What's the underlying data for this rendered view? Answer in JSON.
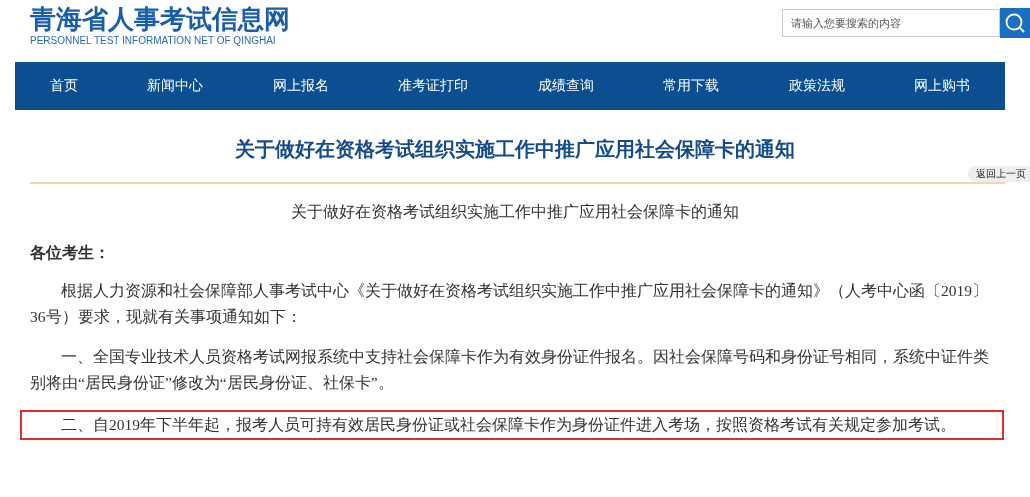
{
  "site": {
    "title": "青海省人事考试信息网",
    "subtitle": "PERSONNEL TEST INFORMATION NET OF QINGHAI"
  },
  "search": {
    "placeholder": "请输入您要搜索的内容"
  },
  "nav": [
    "首页",
    "新闻中心",
    "网上报名",
    "准考证打印",
    "成绩查询",
    "常用下载",
    "政策法规",
    "网上购书"
  ],
  "article": {
    "title": "关于做好在资格考试组织实施工作中推广应用社会保障卡的通知",
    "back_button": "返回上一页",
    "heading": "关于做好在资格考试组织实施工作中推广应用社会保障卡的通知",
    "salutation": "各位考生：",
    "paragraphs": [
      {
        "text": "根据人力资源和社会保障部人事考试中心《关于做好在资格考试组织实施工作中推广应用社会保障卡的通知》（人考中心函〔2019〕36号）要求，现就有关事项通知如下：",
        "highlighted": false
      },
      {
        "text": "一、全国专业技术人员资格考试网报系统中支持社会保障卡作为有效身份证件报名。因社会保障号码和身份证号相同，系统中证件类别将由“居民身份证”修改为“居民身份证、社保卡”。",
        "highlighted": false
      },
      {
        "text": "二、自2019年下半年起，报考人员可持有效居民身份证或社会保障卡作为身份证件进入考场，按照资格考试有关规定参加考试。",
        "highlighted": true
      }
    ]
  }
}
